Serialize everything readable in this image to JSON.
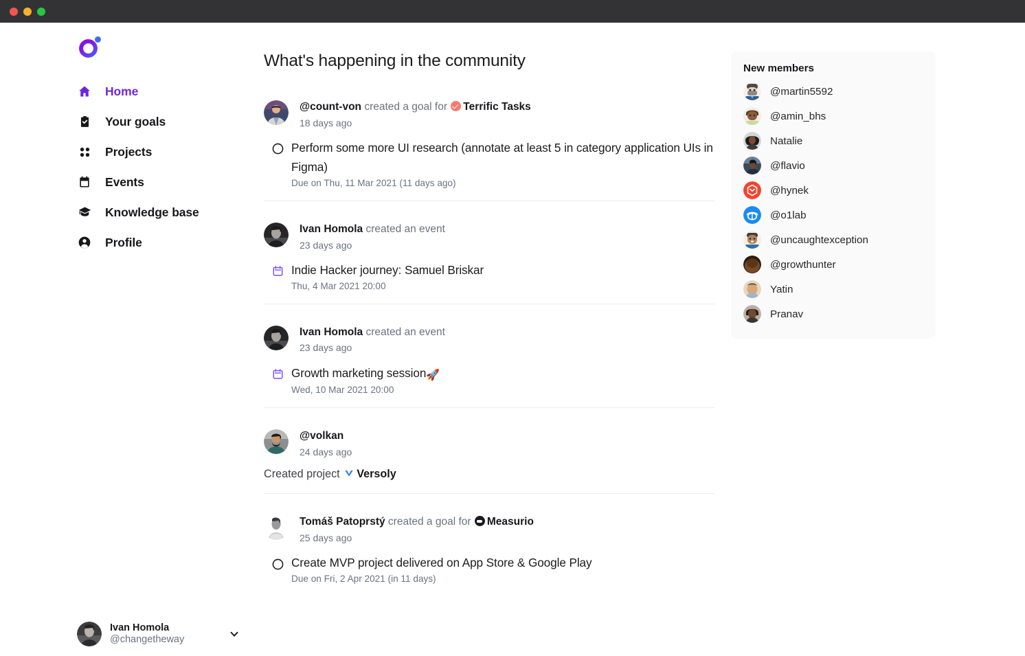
{
  "window": {
    "traffic_lights": [
      "close",
      "minimize",
      "maximize"
    ],
    "titlebar_color": "#333336"
  },
  "brand": {
    "logo_name": "gradient-ring-logo",
    "accent": "#6d28d9"
  },
  "sidebar": {
    "items": [
      {
        "label": "Home",
        "icon": "home-icon",
        "active": true
      },
      {
        "label": "Your goals",
        "icon": "clipboard-check-icon",
        "active": false
      },
      {
        "label": "Projects",
        "icon": "grid-dots-icon",
        "active": false
      },
      {
        "label": "Events",
        "icon": "calendar-icon",
        "active": false
      },
      {
        "label": "Knowledge base",
        "icon": "graduation-cap-icon",
        "active": false
      },
      {
        "label": "Profile",
        "icon": "user-circle-icon",
        "active": false
      }
    ],
    "footer": {
      "name": "Ivan Homola",
      "handle": "@changetheway",
      "avatar": "ivan-homola-avatar",
      "chevron": "chevron-down-icon"
    }
  },
  "feed": {
    "title": "What's happening in the community",
    "posts": [
      {
        "author": "@count-von",
        "action": "created a goal for",
        "target": "Terrific Tasks",
        "target_badge": "terrific-tasks-logo",
        "time": "18 days ago",
        "kind": "goal",
        "body_icon": "goal-circle-icon",
        "body_title": "Perform some more UI research (annotate at least 5 in category application UIs in Figma)",
        "body_sub": "Due on Thu, 11 Mar 2021 (11 days ago)"
      },
      {
        "author": "Ivan Homola",
        "action": "created an event",
        "target": "",
        "target_badge": "",
        "time": "23 days ago",
        "kind": "event",
        "body_icon": "calendar-outline-icon",
        "body_title": "Indie Hacker journey: Samuel Briskar",
        "body_sub": "Thu, 4 Mar 2021 20:00"
      },
      {
        "author": "Ivan Homola",
        "action": "created an event",
        "target": "",
        "target_badge": "",
        "time": "23 days ago",
        "kind": "event",
        "body_icon": "calendar-outline-icon",
        "body_title": "Growth marketing session",
        "body_emoji": "🚀",
        "body_sub": "Wed, 10 Mar 2021 20:00"
      },
      {
        "author": "@volkan",
        "action": "",
        "target": "",
        "target_badge": "",
        "time": "24 days ago",
        "kind": "project",
        "body_prefix": "Created project",
        "body_badge": "versoly-logo",
        "body_target": "Versoly"
      },
      {
        "author": "Tomáš Patoprstý",
        "action": "created a goal for",
        "target": "Measurio",
        "target_badge": "measurio-logo",
        "time": "25 days ago",
        "kind": "goal",
        "body_icon": "goal-circle-icon",
        "body_title": "Create MVP project delivered on App Store & Google Play",
        "body_sub": "Due on Fri, 2 Apr 2021 (in 11 days)"
      }
    ]
  },
  "members_panel": {
    "title": "New members",
    "members": [
      {
        "name": "@martin5592",
        "avatar": "cartoon-bearded-man-avatar"
      },
      {
        "name": "@amin_bhs",
        "avatar": "cartoon-brown-avatar"
      },
      {
        "name": "Natalie",
        "avatar": "photo-woman-avatar"
      },
      {
        "name": "@flavio",
        "avatar": "photo-person-avatar"
      },
      {
        "name": "@hynek",
        "avatar": "red-hexagon-logo-avatar"
      },
      {
        "name": "@o1lab",
        "avatar": "blue-circle-logo-avatar"
      },
      {
        "name": "@uncaughtexception",
        "avatar": "cartoon-smiling-avatar"
      },
      {
        "name": "@growthunter",
        "avatar": "brown-photo-avatar"
      },
      {
        "name": "Yatin",
        "avatar": "photo-man-avatar"
      },
      {
        "name": "Pranav",
        "avatar": "photo-dark-avatar"
      }
    ]
  }
}
